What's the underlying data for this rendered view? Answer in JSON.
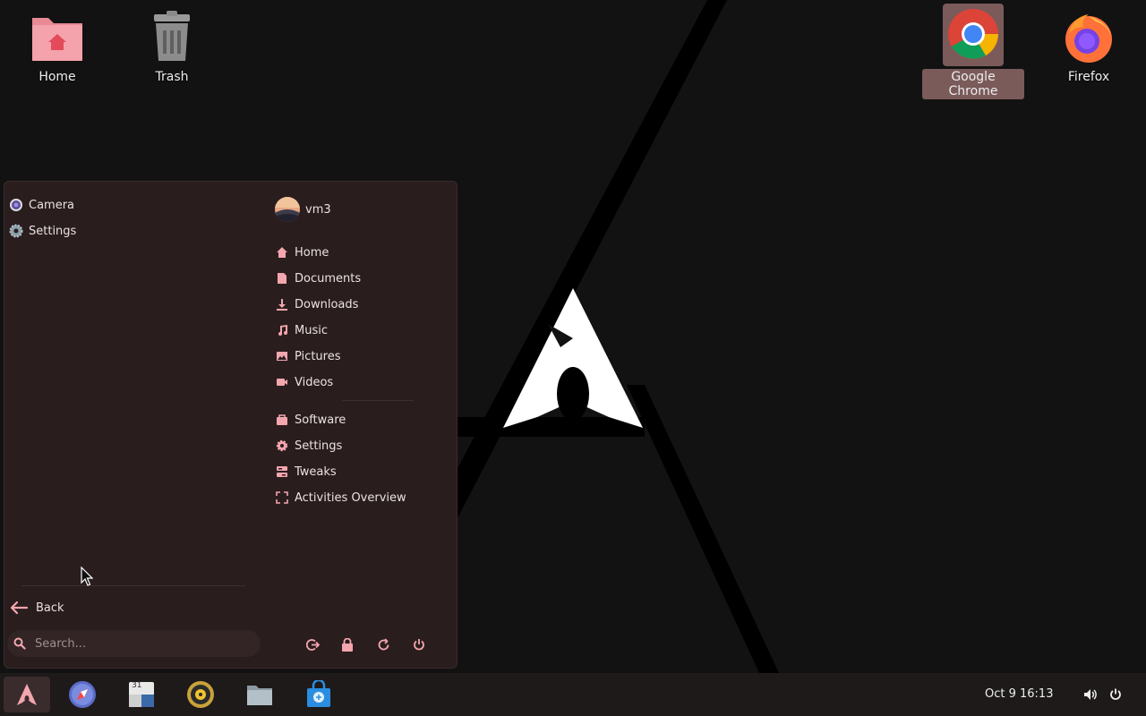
{
  "desktop": {
    "icons": [
      {
        "label": "Home",
        "icon": "home-folder-icon"
      },
      {
        "label": "Trash",
        "icon": "trash-icon"
      },
      {
        "label": "Google Chrome",
        "icon": "chrome-icon"
      },
      {
        "label": "Firefox",
        "icon": "firefox-icon"
      }
    ]
  },
  "menu": {
    "categories": [
      {
        "label": "Camera",
        "icon": "camera-icon"
      },
      {
        "label": "Settings",
        "icon": "settings-gear-icon"
      }
    ],
    "user": {
      "name": "vm3"
    },
    "places": [
      {
        "label": "Home",
        "icon": "home-icon"
      },
      {
        "label": "Documents",
        "icon": "document-icon"
      },
      {
        "label": "Downloads",
        "icon": "download-icon"
      },
      {
        "label": "Music",
        "icon": "music-icon"
      },
      {
        "label": "Pictures",
        "icon": "picture-icon"
      },
      {
        "label": "Videos",
        "icon": "video-icon"
      }
    ],
    "system": [
      {
        "label": "Software",
        "icon": "software-bag-icon"
      },
      {
        "label": "Settings",
        "icon": "gear-icon"
      },
      {
        "label": "Tweaks",
        "icon": "tweaks-icon"
      },
      {
        "label": "Activities Overview",
        "icon": "overview-icon"
      }
    ],
    "back_label": "Back",
    "search_placeholder": "Search..."
  },
  "panel": {
    "dock": [
      "arch-menu-icon",
      "browser-compass-icon",
      "calendar-icon",
      "music-player-icon",
      "files-icon",
      "software-store-icon"
    ],
    "calendar_day": "31",
    "clock": "Oct 9  16:13"
  },
  "colors": {
    "accent": "#f4a6ae",
    "menu_bg": "#2a1d1e",
    "panel_bg": "#1e1a1a"
  }
}
